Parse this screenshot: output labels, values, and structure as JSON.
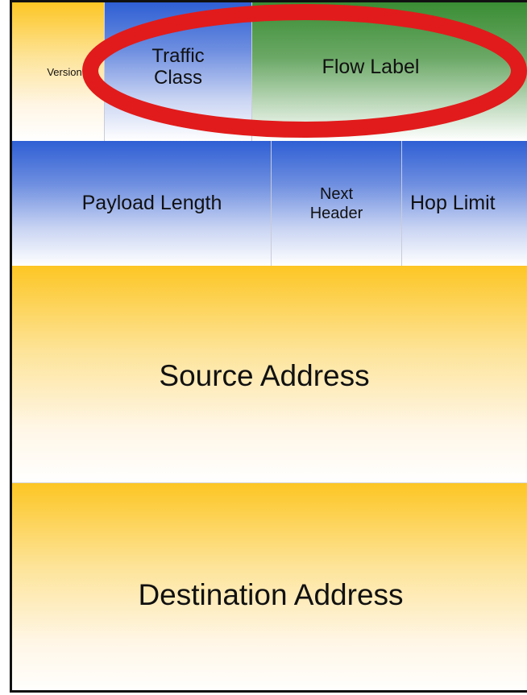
{
  "header": {
    "row1": {
      "version": "Version",
      "traffic_class": "Traffic Class",
      "flow_label": "Flow Label"
    },
    "row2": {
      "payload_length": "Payload Length",
      "next_header": "Next Header",
      "hop_limit": "Hop Limit"
    },
    "source_address": "Source Address",
    "destination_address": "Destination Address"
  },
  "highlight": {
    "color": "#e11b1b",
    "target": "Traffic Class, Flow Label"
  },
  "colors": {
    "gold": "#fdc624",
    "blue": "#2e5fd4",
    "green": "#3a8d34"
  }
}
